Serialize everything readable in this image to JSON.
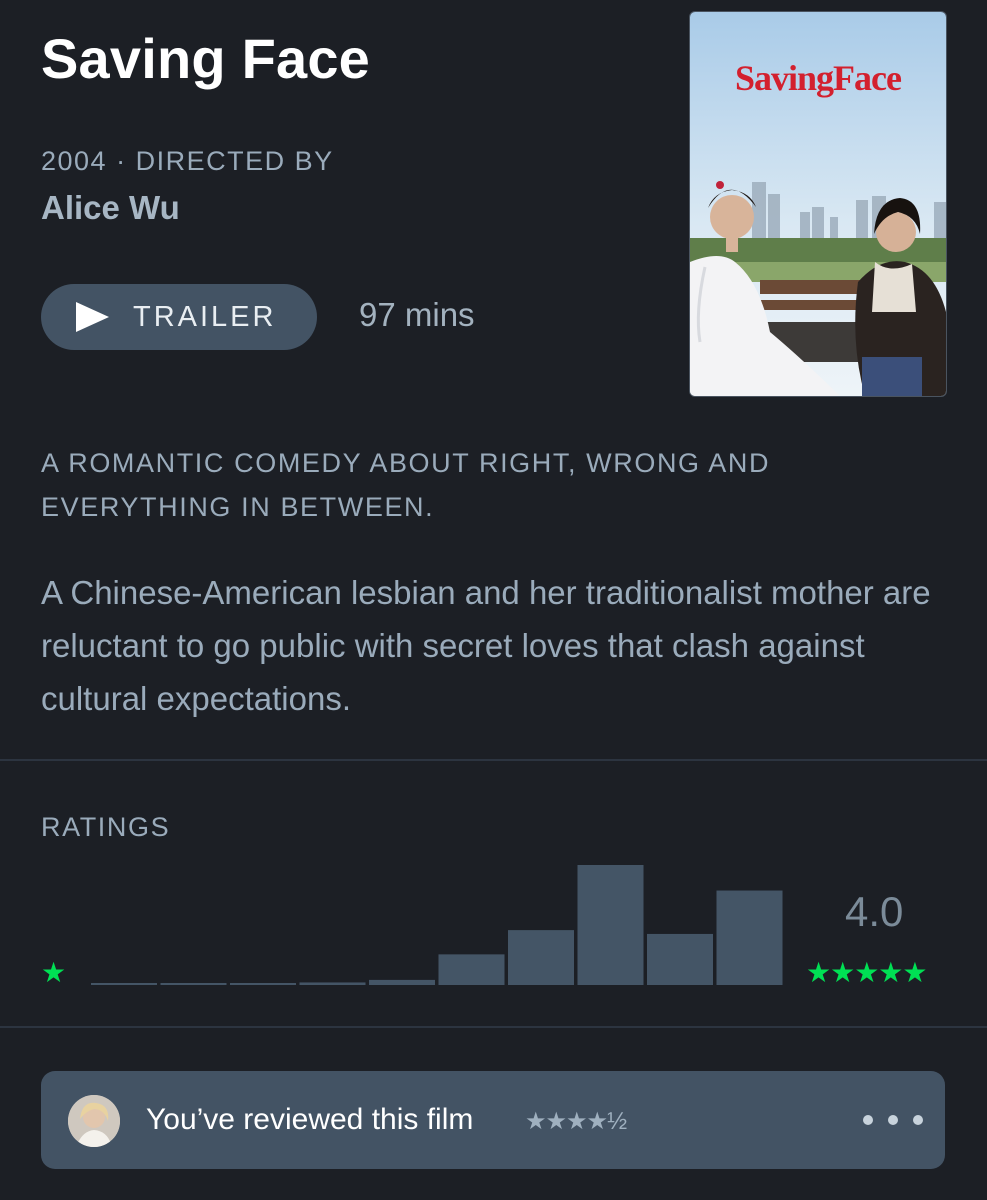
{
  "film": {
    "title": "Saving Face",
    "year": "2004",
    "directed_by_label": "· DIRECTED BY",
    "director": "Alice Wu",
    "runtime": "97 mins",
    "tagline": "A ROMANTIC COMEDY ABOUT RIGHT, WRONG AND EVERYTHING IN BETWEEN.",
    "synopsis": "A Chinese-American lesbian and her traditionalist mother are reluctant to go public with secret loves that clash against cultural expectations.",
    "poster_title": "SavingFace"
  },
  "trailer": {
    "label": "TRAILER",
    "icon": "play-icon"
  },
  "ratings": {
    "label": "RATINGS",
    "average": "4.0",
    "low_star": "★",
    "high_stars": "★★★★★",
    "accent": "#00e054",
    "bar_color": "#445566"
  },
  "chart_data": {
    "type": "bar",
    "categories": [
      "0.5",
      "1",
      "1.5",
      "2",
      "2.5",
      "3",
      "3.5",
      "4",
      "4.5",
      "5"
    ],
    "values": [
      1,
      1,
      1,
      2,
      4,
      24,
      43,
      94,
      40,
      74
    ],
    "title": "",
    "xlabel": "",
    "ylabel": "",
    "ylim": [
      0,
      94
    ]
  },
  "review": {
    "text": "You’ve reviewed this film",
    "stars": "★★★★½",
    "more_icon": "more-dots-icon"
  }
}
